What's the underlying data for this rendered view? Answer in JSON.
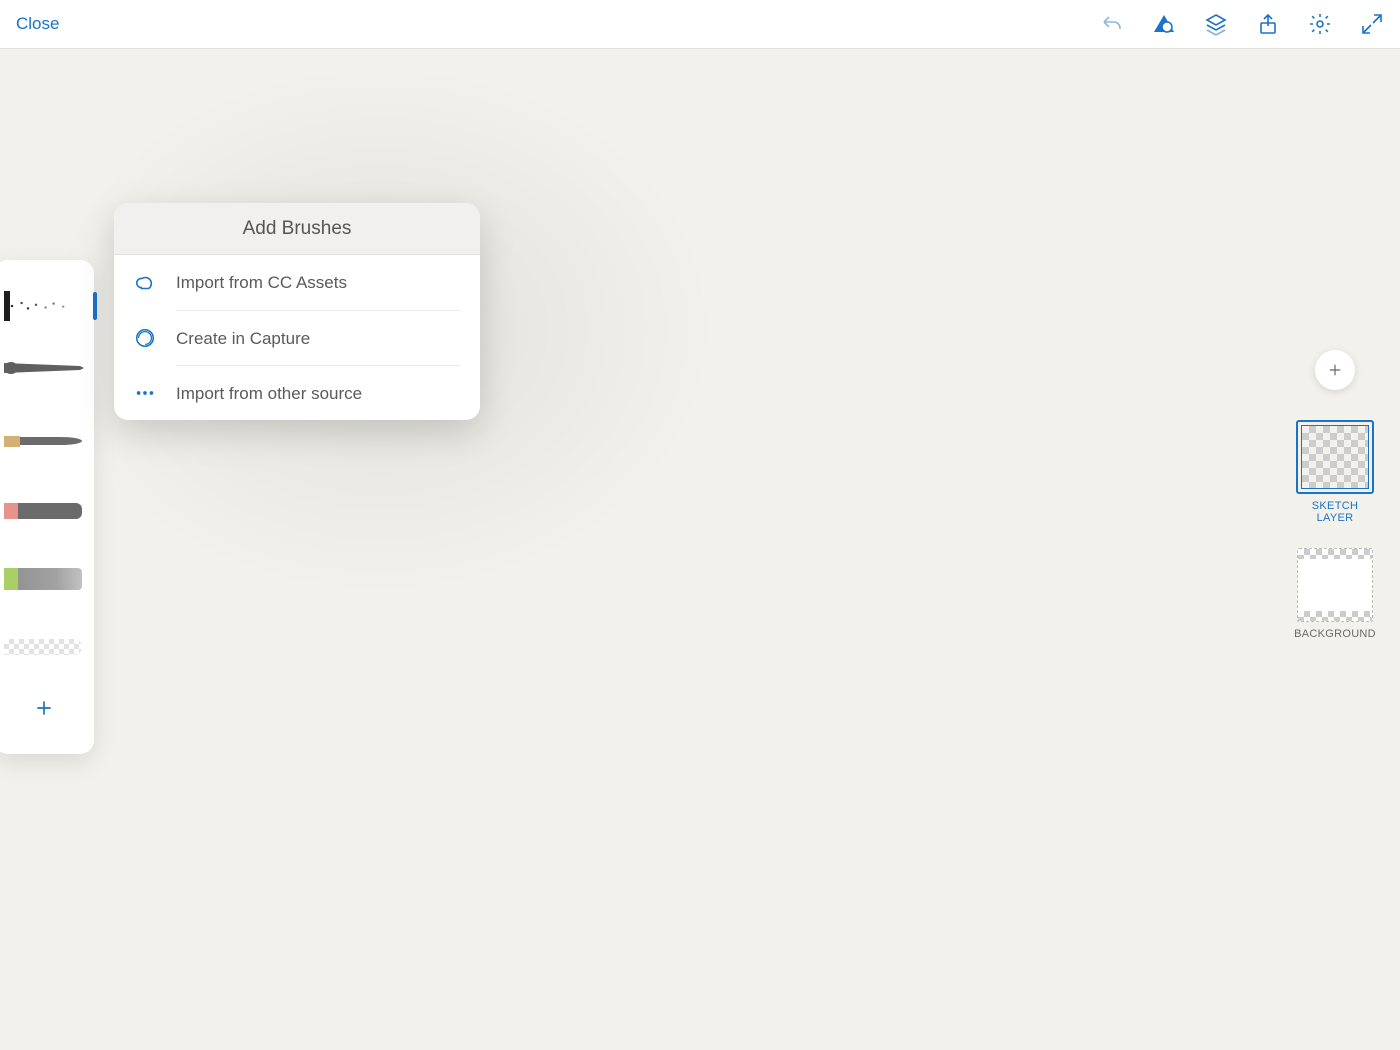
{
  "topbar": {
    "close_label": "Close"
  },
  "popover": {
    "title": "Add Brushes",
    "items": [
      {
        "label": "Import from CC Assets"
      },
      {
        "label": "Create in Capture"
      },
      {
        "label": "Import from other source"
      }
    ]
  },
  "layers": {
    "sketch_label": "SKETCH LAYER",
    "background_label": "BACKGROUND"
  }
}
